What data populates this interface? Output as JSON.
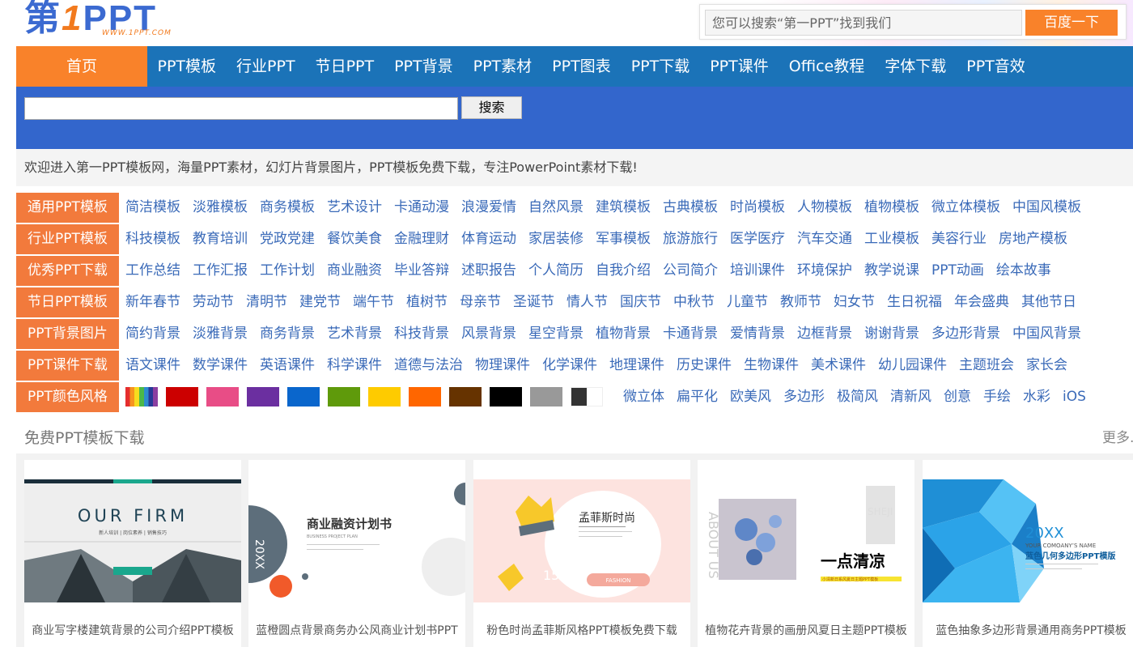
{
  "logo": {
    "main": "第1PPT",
    "sub": "WWW.1PPT.COM"
  },
  "top_search": {
    "placeholder": "您可以搜索“第一PPT”找到我们",
    "button": "百度一下"
  },
  "nav": {
    "home": "首页",
    "items": [
      "PPT模板",
      "行业PPT",
      "节日PPT",
      "PPT背景",
      "PPT素材",
      "PPT图表",
      "PPT下载",
      "PPT课件",
      "Office教程",
      "字体下载",
      "PPT音效"
    ]
  },
  "site_search": {
    "button": "搜索",
    "value": ""
  },
  "welcome": "欢迎进入第一PPT模板网，海量PPT素材，幻灯片背景图片，PPT模板免费下载，专注PowerPoint素材下载!",
  "categories": [
    {
      "label": "通用PPT模板",
      "links": [
        "简洁模板",
        "淡雅模板",
        "商务模板",
        "艺术设计",
        "卡通动漫",
        "浪漫爱情",
        "自然风景",
        "建筑模板",
        "古典模板",
        "时尚模板",
        "人物模板",
        "植物模板",
        "微立体模板",
        "中国风模板"
      ]
    },
    {
      "label": "行业PPT模板",
      "links": [
        "科技模板",
        "教育培训",
        "党政党建",
        "餐饮美食",
        "金融理财",
        "体育运动",
        "家居装修",
        "军事模板",
        "旅游旅行",
        "医学医疗",
        "汽车交通",
        "工业模板",
        "美容行业",
        "房地产模板"
      ]
    },
    {
      "label": "优秀PPT下载",
      "links": [
        "工作总结",
        "工作汇报",
        "工作计划",
        "商业融资",
        "毕业答辩",
        "述职报告",
        "个人简历",
        "自我介绍",
        "公司简介",
        "培训课件",
        "环境保护",
        "教学说课",
        "PPT动画",
        "绘本故事"
      ]
    },
    {
      "label": "节日PPT模板",
      "links": [
        "新年春节",
        "劳动节",
        "清明节",
        "建党节",
        "端午节",
        "植树节",
        "母亲节",
        "圣诞节",
        "情人节",
        "国庆节",
        "中秋节",
        "儿童节",
        "教师节",
        "妇女节",
        "生日祝福",
        "年会盛典",
        "其他节日"
      ]
    },
    {
      "label": "PPT背景图片",
      "links": [
        "简约背景",
        "淡雅背景",
        "商务背景",
        "艺术背景",
        "科技背景",
        "风景背景",
        "星空背景",
        "植物背景",
        "卡通背景",
        "爱情背景",
        "边框背景",
        "谢谢背景",
        "多边形背景",
        "中国风背景"
      ]
    },
    {
      "label": "PPT课件下载",
      "links": [
        "语文课件",
        "数学课件",
        "英语课件",
        "科学课件",
        "道德与法治",
        "物理课件",
        "化学课件",
        "地理课件",
        "历史课件",
        "生物课件",
        "美术课件",
        "幼儿园课件",
        "主题班会",
        "家长会"
      ]
    }
  ],
  "color_row": {
    "label": "PPT颜色风格",
    "swatches": [
      "rainbow",
      "#cc0000",
      "#e84d86",
      "#6b2fa0",
      "#0a66cc",
      "#5f9a0b",
      "#fecb00",
      "#ff6600",
      "#663300",
      "#000000",
      "#999999",
      "black-white"
    ],
    "links": [
      "微立体",
      "扁平化",
      "欧美风",
      "多边形",
      "极简风",
      "清新风",
      "创意",
      "手绘",
      "水彩",
      "iOS"
    ]
  },
  "section": {
    "title": "免费PPT模板下载",
    "more": "更多..."
  },
  "cards": [
    {
      "caption": "商业写字楼建筑背景的公司介绍PPT模板",
      "img_title": "OUR FIRM",
      "img_sub": "新人培训 | 岗位素养 | 销售技巧"
    },
    {
      "caption": "蓝橙圆点背景商务办公风商业计划书PPT",
      "img_title": "商业融资计划书",
      "img_sub": "BUSINESS PROJECT PLAN",
      "img_year": "20XX"
    },
    {
      "caption": "粉色时尚孟菲斯风格PPT模板免费下载",
      "img_title": "孟菲斯时尚",
      "img_num": "15",
      "img_tag": "FASHION"
    },
    {
      "caption": "植物花卉背景的画册风夏日主题PPT模板",
      "img_title": "一点清凉",
      "img_side": "ABOUT US",
      "img_sub": "小清新日系风夏日主题PPT模板"
    },
    {
      "caption": "蓝色抽象多边形背景通用商务PPT模板",
      "img_title": "蓝色几何多边形PPT模版",
      "img_year": "20XX",
      "img_sub": "YOUR COMOANY’S NAME"
    }
  ]
}
